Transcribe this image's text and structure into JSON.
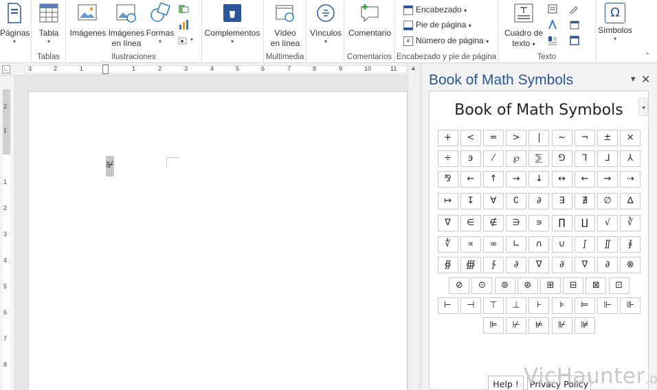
{
  "ribbon": {
    "groups": {
      "pages": {
        "btn": "Páginas",
        "label": ""
      },
      "tables": {
        "btn": "Tabla",
        "label": "Tablas"
      },
      "illustrations": {
        "label": "Ilustraciones",
        "images": "Imágenes",
        "online_images_1": "Imágenes",
        "online_images_2": "en línea",
        "shapes": "Formas"
      },
      "addins": {
        "btn": "Complementos",
        "label": ""
      },
      "media": {
        "btn1": "Vídeo",
        "btn2": "en línea",
        "label": "Multimedia"
      },
      "links": {
        "btn": "Vínculos",
        "label": ""
      },
      "comments": {
        "btn": "Comentario",
        "label": "Comentarios"
      },
      "header_footer": {
        "header": "Encabezado",
        "footer": "Pie de página",
        "page_number": "Número de página",
        "label": "Encabezado y pie de página"
      },
      "text": {
        "textbox_1": "Cuadro de",
        "textbox_2": "texto",
        "label": "Texto"
      },
      "symbols": {
        "btn": "Símbolos",
        "omega": "Ω",
        "label": ""
      }
    }
  },
  "ruler": {
    "h_labels": [
      "3",
      "2",
      "1",
      "1",
      "2",
      "3",
      "4",
      "5",
      "6",
      "7",
      "8",
      "9",
      "10",
      "11"
    ],
    "v_labels": [
      "2",
      "1",
      "1",
      "2",
      "3",
      "4",
      "5",
      "6",
      "7",
      "8"
    ]
  },
  "document": {
    "selected_symbol": "⊮"
  },
  "colors": {
    "accent": "#2b579a",
    "ribbon_border": "#d5d5d5",
    "pane_bg": "#f3f3f3"
  },
  "taskpane": {
    "title": "Book of Math Symbols",
    "close": "✕",
    "dropdown": "▾",
    "inner_title": "Book of Math Symbols",
    "collapse": "◂",
    "rows": [
      [
        "+",
        "<",
        "=",
        ">",
        "|",
        "~",
        "¬",
        "±",
        "×"
      ],
      [
        "÷",
        "϶",
        "⁄",
        "℘",
        "⅀",
        "⅁",
        "⅂",
        "⅃",
        "⅄"
      ],
      [
        "⅋",
        "←",
        "↑",
        "→",
        "↓",
        "↔",
        "⇜",
        "⇝",
        "⇢"
      ],
      [
        "↦",
        "↧",
        "∀",
        "∁",
        "∂",
        "∃",
        "∄",
        "∅",
        "∆"
      ],
      [
        "∇",
        "∈",
        "∉",
        "∋",
        "∍",
        "∏",
        "∐",
        "√",
        "∛"
      ],
      [
        "∜",
        "∝",
        "∞",
        "∟",
        "∩",
        "∪",
        "∫",
        "∬",
        "∮"
      ],
      [
        "∯",
        "∰",
        "∱",
        "∂",
        "∇",
        "∂",
        "∇",
        "∂",
        "⊗"
      ],
      [
        "⊘",
        "⊙",
        "⊚",
        "⊛",
        "⊞",
        "⊟",
        "⊠",
        "⊡"
      ],
      [
        "⊢",
        "⊣",
        "⊤",
        "⊥",
        "⊦",
        "⊧",
        "⊨",
        "⊩",
        "⊪"
      ],
      [
        "⊫",
        "⊬",
        "⊭",
        "⊮",
        "⊯"
      ]
    ],
    "buttons": {
      "help": "Help !",
      "privacy": "Privacy Policy"
    }
  },
  "watermark": {
    "main": "VicHaunter",
    "suffix": ".org"
  }
}
